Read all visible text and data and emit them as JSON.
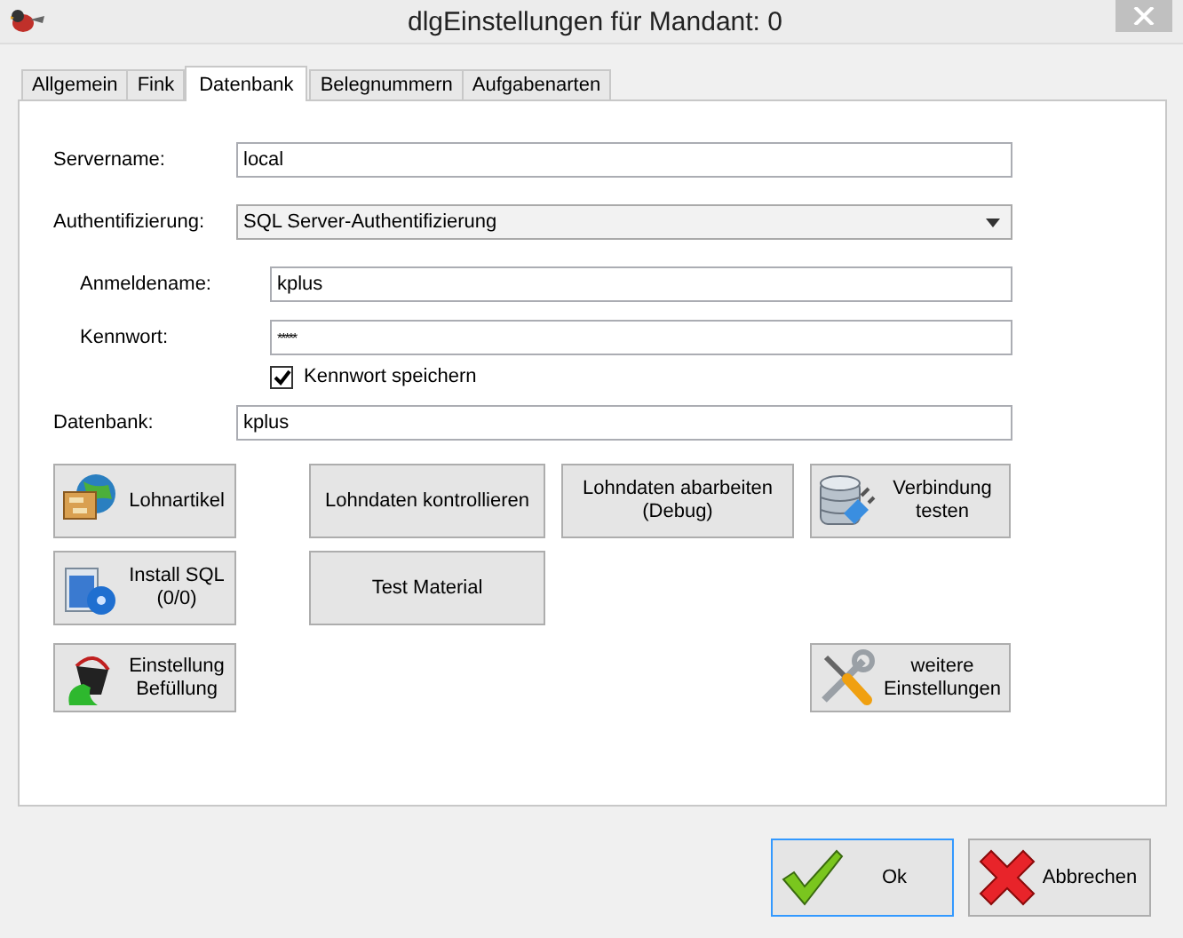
{
  "window": {
    "title": "dlgEinstellungen für Mandant: 0"
  },
  "tabs": [
    {
      "label": "Allgemein",
      "selected": false
    },
    {
      "label": "Fink",
      "selected": false
    },
    {
      "label": "Datenbank",
      "selected": true
    },
    {
      "label": "Belegnummern",
      "selected": false
    },
    {
      "label": "Aufgabenarten",
      "selected": false
    }
  ],
  "fields": [
    {
      "kind": "text",
      "label": "Servername:",
      "value": "local"
    },
    {
      "kind": "select",
      "label": "Authentifizierung:",
      "value": "SQL Server-Authentifizierung",
      "children": [
        {
          "kind": "text",
          "label": "Anmeldename:",
          "value": "kplus"
        },
        {
          "kind": "password",
          "label": "Kennwort:",
          "value": "*****"
        },
        {
          "kind": "checkbox",
          "label": "Kennwort speichern",
          "checked": true
        }
      ]
    },
    {
      "kind": "text",
      "label": "Datenbank:",
      "value": "kplus"
    }
  ],
  "actions": [
    {
      "label": "Lohnartikel"
    },
    {
      "label": "Lohndaten kontrollieren"
    },
    {
      "label": "Lohndaten abarbeiten\n(Debug)"
    },
    {
      "label": "Verbindung\ntesten"
    },
    {
      "label": "Install SQL\n(0/0)"
    },
    {
      "label": "Test Material"
    },
    {
      "label": "Einstellung\nBefüllung"
    },
    {
      "label": "weitere\nEinstellungen"
    }
  ],
  "dialog_buttons": [
    {
      "label": "Ok",
      "focused": true
    },
    {
      "label": "Abbrechen",
      "focused": false
    }
  ]
}
